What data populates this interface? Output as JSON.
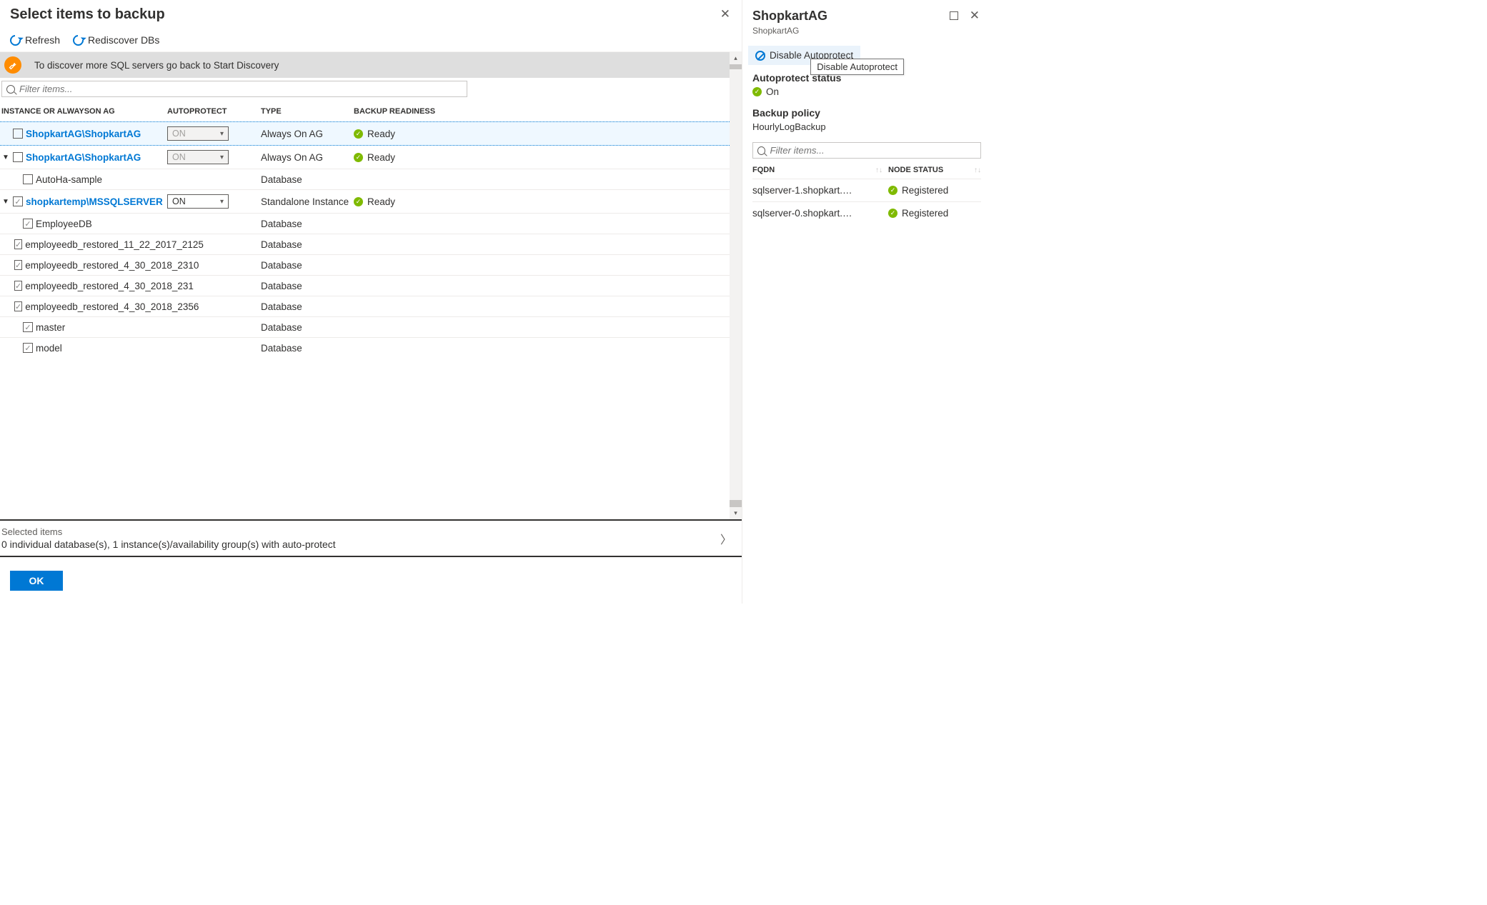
{
  "main": {
    "title": "Select items to backup",
    "toolbar": {
      "refresh": "Refresh",
      "rediscover": "Rediscover DBs"
    },
    "info": "To discover more SQL servers go back to Start Discovery",
    "filter_placeholder": "Filter items...",
    "headers": {
      "instance": "INSTANCE OR ALWAYSON AG",
      "autoprotect": "AUTOPROTECT",
      "type": "TYPE",
      "readiness": "BACKUP READINESS"
    },
    "rows": [
      {
        "expand": "",
        "checked": false,
        "indent": 1,
        "name": "ShopkartAG\\ShopkartAG",
        "link": true,
        "select": "ON",
        "select_disabled": true,
        "type": "Always On AG",
        "ready": "Ready",
        "hl": true
      },
      {
        "expand": "▼",
        "checked": false,
        "indent": 1,
        "name": "ShopkartAG\\ShopkartAG",
        "link": true,
        "select": "ON",
        "select_disabled": true,
        "type": "Always On AG",
        "ready": "Ready"
      },
      {
        "expand": "",
        "checked": false,
        "indent": 2,
        "name": "AutoHa-sample",
        "type": "Database"
      },
      {
        "expand": "▼",
        "checked": true,
        "indent": 1,
        "name": "shopkartemp\\MSSQLSERVER",
        "link": true,
        "select": "ON",
        "select_disabled": false,
        "type": "Standalone Instance",
        "ready": "Ready"
      },
      {
        "expand": "",
        "checked": true,
        "indent": 2,
        "name": "EmployeeDB",
        "type": "Database"
      },
      {
        "expand": "",
        "checked": true,
        "indent": 2,
        "name": "employeedb_restored_11_22_2017_2125",
        "type": "Database"
      },
      {
        "expand": "",
        "checked": true,
        "indent": 2,
        "name": "employeedb_restored_4_30_2018_2310",
        "type": "Database"
      },
      {
        "expand": "",
        "checked": true,
        "indent": 2,
        "name": "employeedb_restored_4_30_2018_231",
        "type": "Database"
      },
      {
        "expand": "",
        "checked": true,
        "indent": 2,
        "name": "employeedb_restored_4_30_2018_2356",
        "type": "Database"
      },
      {
        "expand": "",
        "checked": true,
        "indent": 2,
        "name": "master",
        "type": "Database"
      },
      {
        "expand": "",
        "checked": true,
        "indent": 2,
        "name": "model",
        "type": "Database"
      }
    ],
    "selected": {
      "label": "Selected items",
      "summary": "0 individual database(s), 1 instance(s)/availability group(s) with auto-protect"
    },
    "ok": "OK"
  },
  "panel": {
    "title": "ShopkartAG",
    "subtitle": "ShopkartAG",
    "disable": "Disable Autoprotect",
    "tooltip": "Disable Autoprotect",
    "status_label": "Autoprotect status",
    "status_value": "On",
    "policy_label": "Backup policy",
    "policy_value": "HourlyLogBackup",
    "filter_placeholder": "Filter items...",
    "node_head": {
      "fqdn": "FQDN",
      "status": "NODE STATUS"
    },
    "nodes": [
      {
        "fqdn": "sqlserver-1.shopkart.…",
        "status": "Registered"
      },
      {
        "fqdn": "sqlserver-0.shopkart.…",
        "status": "Registered"
      }
    ]
  }
}
